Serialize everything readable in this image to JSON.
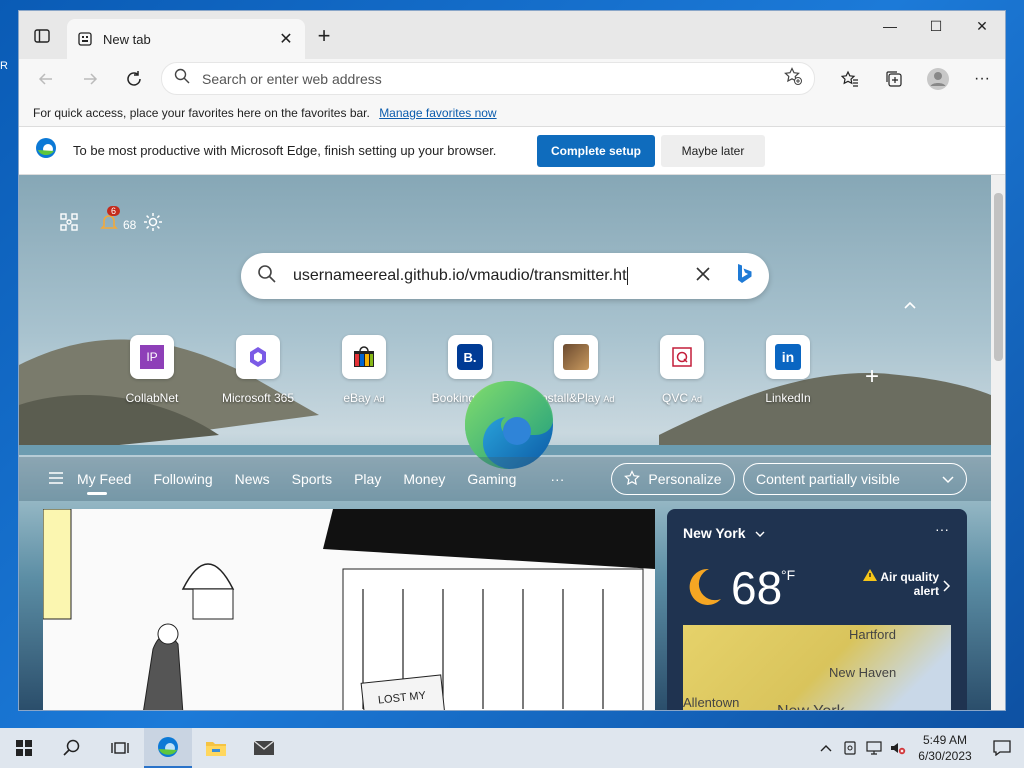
{
  "desktop": {
    "left_label": "R"
  },
  "browser": {
    "tab_title": "New tab",
    "address_placeholder": "Search or enter web address"
  },
  "favbar": {
    "message": "For quick access, place your favorites here on the favorites bar.",
    "link": "Manage favorites now"
  },
  "setup": {
    "message": "To be most productive with Microsoft Edge, finish setting up your browser.",
    "complete_label": "Complete setup",
    "later_label": "Maybe later"
  },
  "ntp": {
    "notification_count": "6",
    "weather_temp_small": "68",
    "search_value": "usernameereal.github.io/vmaudio/transmitter.ht",
    "tiles": [
      {
        "label": "CollabNet",
        "ad": ""
      },
      {
        "label": "Microsoft 365",
        "ad": ""
      },
      {
        "label": "eBay",
        "ad": "Ad"
      },
      {
        "label": "Booking.c...",
        "ad": "Ad"
      },
      {
        "label": "Install&Play",
        "ad": "Ad"
      },
      {
        "label": "QVC",
        "ad": "Ad"
      },
      {
        "label": "LinkedIn",
        "ad": ""
      }
    ],
    "feed_tabs": [
      "My Feed",
      "Following",
      "News",
      "Sports",
      "Play",
      "Money",
      "Gaming"
    ],
    "more_label": "···",
    "personalize_label": "Personalize",
    "content_select": "Content partially visible"
  },
  "weather": {
    "location": "New York",
    "temp": "68",
    "unit": "°F",
    "alert_line1": "Air quality",
    "alert_line2": "alert",
    "map_labels": [
      "Hartford",
      "New Haven",
      "Allentown",
      "New York"
    ]
  },
  "taskbar": {
    "time": "5:49 AM",
    "date": "6/30/2023"
  },
  "colors": {
    "accent": "#0f6cbd",
    "taskbar": "#dfe6ee"
  }
}
